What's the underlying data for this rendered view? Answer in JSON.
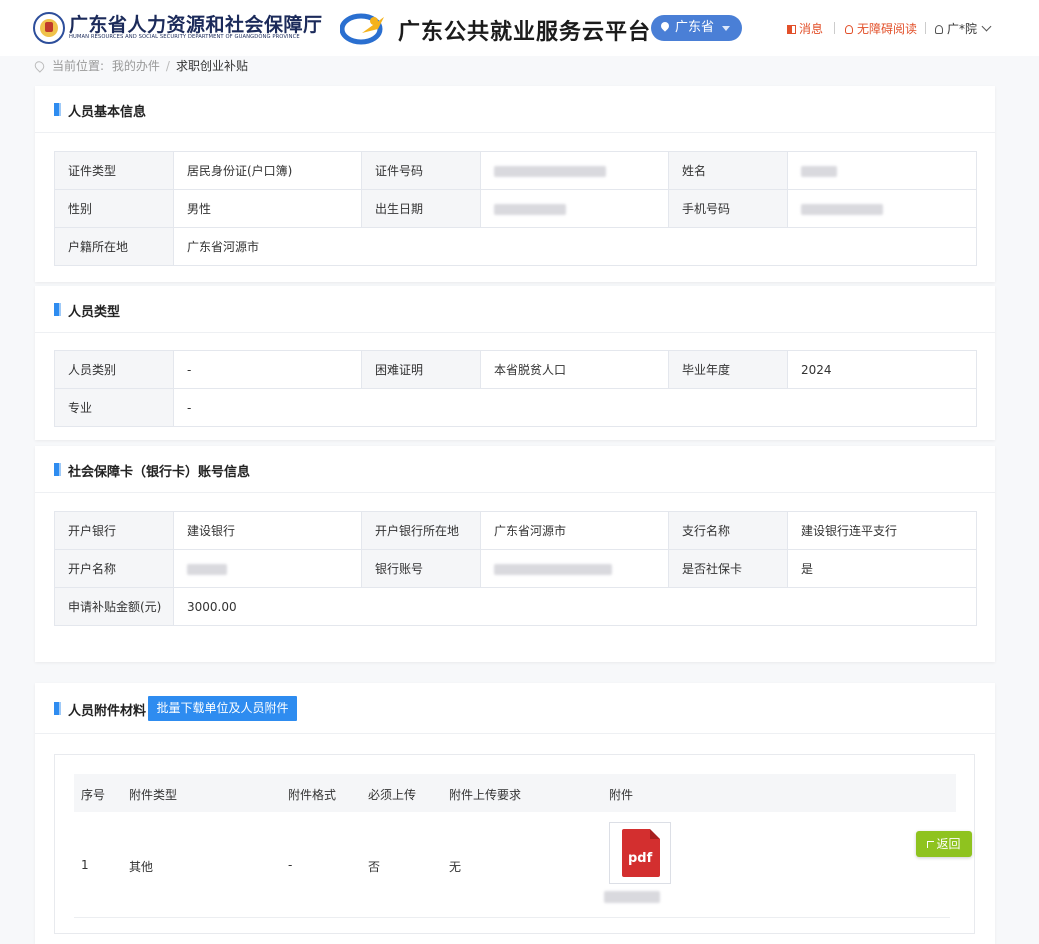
{
  "header": {
    "org_name_cn": "广东省人力资源和社会保障厅",
    "org_name_en": "HUMAN RESOURCES AND SOCIAL SECURITY DEPARTMENT OF GUANGDONG PROVINCE",
    "platform_name": "广东公共就业服务云平台",
    "region": "广东省",
    "nav": {
      "messages": "消息",
      "accessibility": "无障碍阅读",
      "user": "广*院"
    }
  },
  "breadcrumb": {
    "prefix": "当前位置:",
    "parent": "我的办件",
    "separator": "/",
    "current": "求职创业补贴"
  },
  "basic_info": {
    "title": "人员基本信息",
    "labels": {
      "id_type": "证件类型",
      "id_number": "证件号码",
      "name": "姓名",
      "gender": "性别",
      "birth_date": "出生日期",
      "phone": "手机号码",
      "household": "户籍所在地"
    },
    "values": {
      "id_type": "居民身份证(户口簿)",
      "gender": "男性",
      "household": "广东省河源市"
    }
  },
  "person_type": {
    "title": "人员类型",
    "labels": {
      "category": "人员类别",
      "hardship_proof": "困难证明",
      "grad_year": "毕业年度",
      "major": "专业"
    },
    "values": {
      "category": "-",
      "hardship_proof": "本省脱贫人口",
      "grad_year": "2024",
      "major": "-"
    }
  },
  "bank_info": {
    "title": "社会保障卡（银行卡）账号信息",
    "labels": {
      "bank": "开户银行",
      "bank_location": "开户银行所在地",
      "branch": "支行名称",
      "account_name": "开户名称",
      "account_number": "银行账号",
      "is_social_card": "是否社保卡",
      "subsidy_amount": "申请补贴金额(元)"
    },
    "values": {
      "bank": "建设银行",
      "bank_location": "广东省河源市",
      "branch": "建设银行连平支行",
      "is_social_card": "是",
      "subsidy_amount": "3000.00"
    }
  },
  "attachments": {
    "title": "人员附件材料",
    "batch_download_label": "批量下载单位及人员附件",
    "columns": {
      "index": "序号",
      "type": "附件类型",
      "format": "附件格式",
      "required": "必须上传",
      "requirement": "附件上传要求",
      "file": "附件"
    },
    "rows": [
      {
        "index": "1",
        "type": "其他",
        "format": "-",
        "required": "否",
        "requirement": "无",
        "file_icon": "pdf"
      }
    ]
  },
  "return_label": "返回",
  "colors": {
    "accent": "#2e8cf0",
    "nav_warn": "#e2502a",
    "return_green": "#8fc31f",
    "region_pill": "#4a7fd6"
  }
}
